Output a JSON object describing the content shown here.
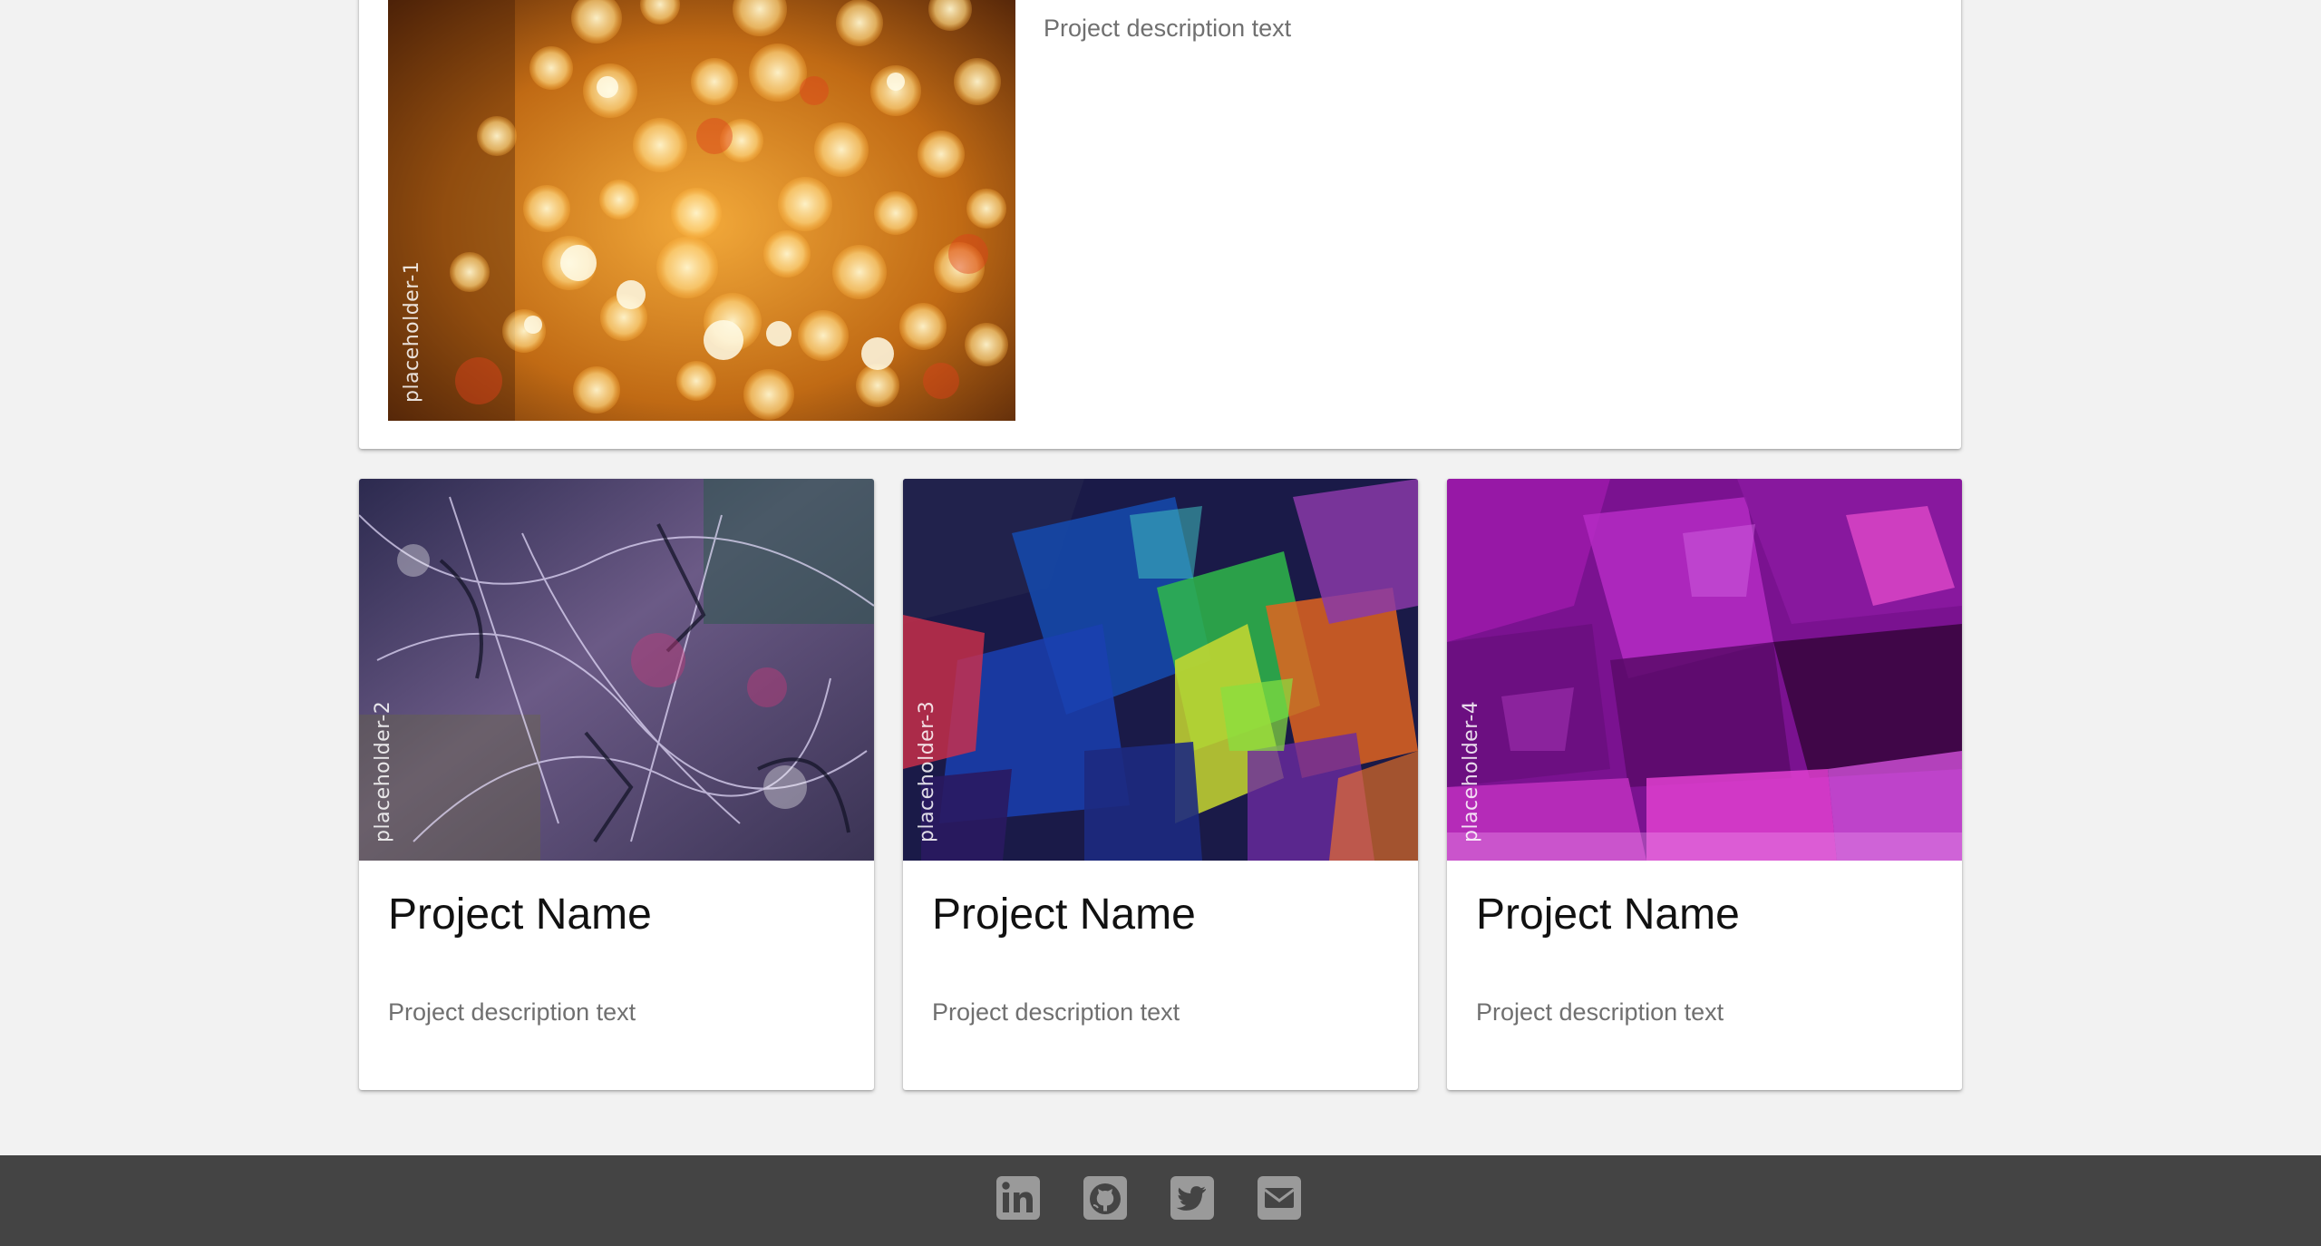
{
  "featured": {
    "image_label": "placeholder-1",
    "description": "Project description text"
  },
  "projects": [
    {
      "image_label": "placeholder-2",
      "name": "Project Name",
      "description": "Project description text"
    },
    {
      "image_label": "placeholder-3",
      "name": "Project Name",
      "description": "Project description text"
    },
    {
      "image_label": "placeholder-4",
      "name": "Project Name",
      "description": "Project description text"
    }
  ],
  "footer": {
    "icons": [
      "linkedin-icon",
      "github-icon",
      "twitter-icon",
      "email-icon"
    ],
    "background": "#444444",
    "icon_color": "#9a9a9a"
  }
}
